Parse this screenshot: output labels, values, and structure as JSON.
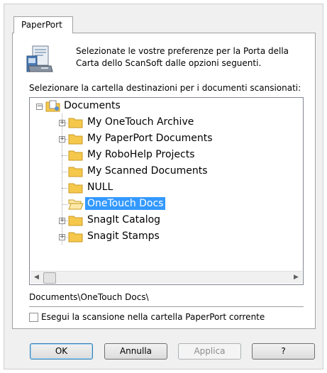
{
  "window": {
    "tab_label": "PaperPort"
  },
  "header": {
    "description": "Selezionate le vostre preferenze per la Porta della Carta dello ScanSoft dalle opzioni seguenti.",
    "icon": "paperport-scanner-icon"
  },
  "tree": {
    "label": "Selezionare la cartella destinazioni per i documenti scansionati:",
    "root": {
      "label": "Documents",
      "expanded": true
    },
    "items": [
      {
        "label": "My OneTouch Archive",
        "expandable": true,
        "selected": false
      },
      {
        "label": "My PaperPort Documents",
        "expandable": true,
        "selected": false
      },
      {
        "label": "My RoboHelp Projects",
        "expandable": false,
        "selected": false
      },
      {
        "label": "My Scanned Documents",
        "expandable": false,
        "selected": false
      },
      {
        "label": "NULL",
        "expandable": false,
        "selected": false
      },
      {
        "label": "OneTouch Docs",
        "expandable": false,
        "selected": true
      },
      {
        "label": "SnagIt Catalog",
        "expandable": true,
        "selected": false
      },
      {
        "label": "Snagit Stamps",
        "expandable": true,
        "selected": false
      }
    ]
  },
  "path": "Documents\\OneTouch Docs\\",
  "option": {
    "label": "Esegui la scansione nella cartella PaperPort corrente",
    "checked": false
  },
  "buttons": {
    "ok": "OK",
    "cancel": "Annulla",
    "apply": "Applica",
    "help": "?"
  },
  "colors": {
    "selection": "#3399ff",
    "folder": "#f5c84c",
    "dialog_bg": "#f0f0f0"
  }
}
